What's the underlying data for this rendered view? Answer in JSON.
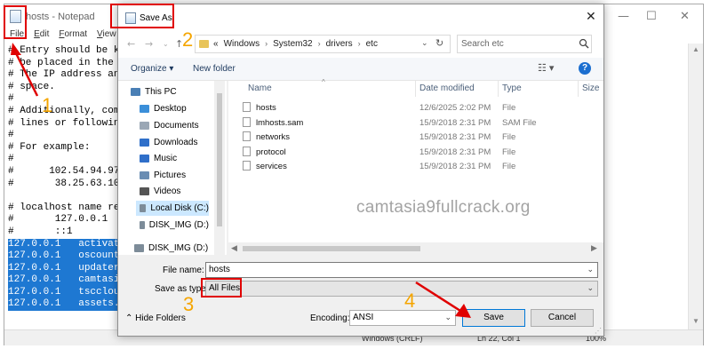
{
  "notepad": {
    "title": "hosts - Notepad",
    "menu": [
      "File",
      "Edit",
      "Format",
      "View"
    ],
    "lines": [
      "# Entry should be ke",
      "# be placed in the f",
      "# The IP address and",
      "# space.",
      "#",
      "# Additionally, comm",
      "# lines or following",
      "#",
      "# For example:",
      "#",
      "#      102.54.94.97",
      "#       38.25.63.10",
      "",
      "# localhost name res",
      "#       127.0.0.1",
      "#       ::1",
      "127.0.0.1   activat",
      "127.0.0.1   oscount",
      "127.0.0.1   updater",
      "127.0.0.1   camtasi",
      "127.0.0.1   tsccloud",
      "127.0.0.1   assets."
    ],
    "status": {
      "encoding": "Windows (CRLF)",
      "position": "Ln 22, Col 1",
      "zoom": "100%"
    }
  },
  "dialog": {
    "title": "Save As",
    "address": {
      "crumbs": [
        "Windows",
        "System32",
        "drivers",
        "etc"
      ],
      "prefix": "«"
    },
    "search_placeholder": "Search etc",
    "organize": "Organize ▾",
    "new_folder": "New folder",
    "nav_items": [
      {
        "label": "This PC",
        "color": "#4a7fb5"
      },
      {
        "label": "Desktop",
        "color": "#3b8fd9"
      },
      {
        "label": "Documents",
        "color": "#9aa7b5"
      },
      {
        "label": "Downloads",
        "color": "#2f6fc9"
      },
      {
        "label": "Music",
        "color": "#2f6fc9"
      },
      {
        "label": "Pictures",
        "color": "#6a8db3"
      },
      {
        "label": "Videos",
        "color": "#555"
      },
      {
        "label": "Local Disk (C:)",
        "color": "#7d8c99"
      },
      {
        "label": "DISK_IMG (D:)",
        "color": "#7d8c99"
      },
      {
        "label": "DISK_IMG (D:)",
        "color": "#7d8c99"
      }
    ],
    "columns": [
      "Name",
      "Date modified",
      "Type",
      "Size"
    ],
    "files": [
      {
        "name": "hosts",
        "date": "12/6/2025 2:02 PM",
        "type": "File"
      },
      {
        "name": "lmhosts.sam",
        "date": "15/9/2018 2:31 PM",
        "type": "SAM File"
      },
      {
        "name": "networks",
        "date": "15/9/2018 2:31 PM",
        "type": "File"
      },
      {
        "name": "protocol",
        "date": "15/9/2018 2:31 PM",
        "type": "File"
      },
      {
        "name": "services",
        "date": "15/9/2018 2:31 PM",
        "type": "File"
      }
    ],
    "watermark": "camtasia9fullcrack.org",
    "file_name_label": "File name:",
    "file_name_value": "hosts",
    "save_as_type_label": "Save as type:",
    "save_as_type_value": "All Files",
    "hide_folders": "Hide Folders",
    "encoding_label": "Encoding:",
    "encoding_value": "ANSI",
    "save": "Save",
    "cancel": "Cancel"
  },
  "annotations": {
    "steps": [
      "1",
      "2",
      "3",
      "4"
    ],
    "box_color": "#e00000",
    "step_color": "#f5a500"
  }
}
